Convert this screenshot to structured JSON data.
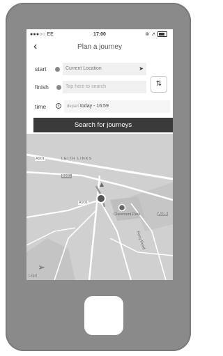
{
  "status": {
    "carrier": "●●●○○ EE",
    "time": "17:00",
    "extras": "⊛ ➚"
  },
  "nav": {
    "back_icon": "chevron-left",
    "title": "Plan a journey"
  },
  "form": {
    "start_label": "start",
    "start_value": "Current Location",
    "finish_label": "finish",
    "finish_placeholder": "Tap here to search",
    "time_label": "time",
    "time_prefix": "depart",
    "time_value": "today - 16:59",
    "swap_icon": "⇅"
  },
  "search_button": "Search for journeys",
  "map": {
    "labels": {
      "area": "LEITH LINKS",
      "road_a901": "A901",
      "road_b": "B901",
      "road_a": "A901",
      "park": "Claremont Park",
      "road_right": "A199",
      "pier": "Ferry Road"
    },
    "attribution": "Legal"
  },
  "colors": {
    "phone_body": "#8a8a8a",
    "button_dark": "#3a3a3a",
    "map_bg": "#d2d2d2"
  }
}
